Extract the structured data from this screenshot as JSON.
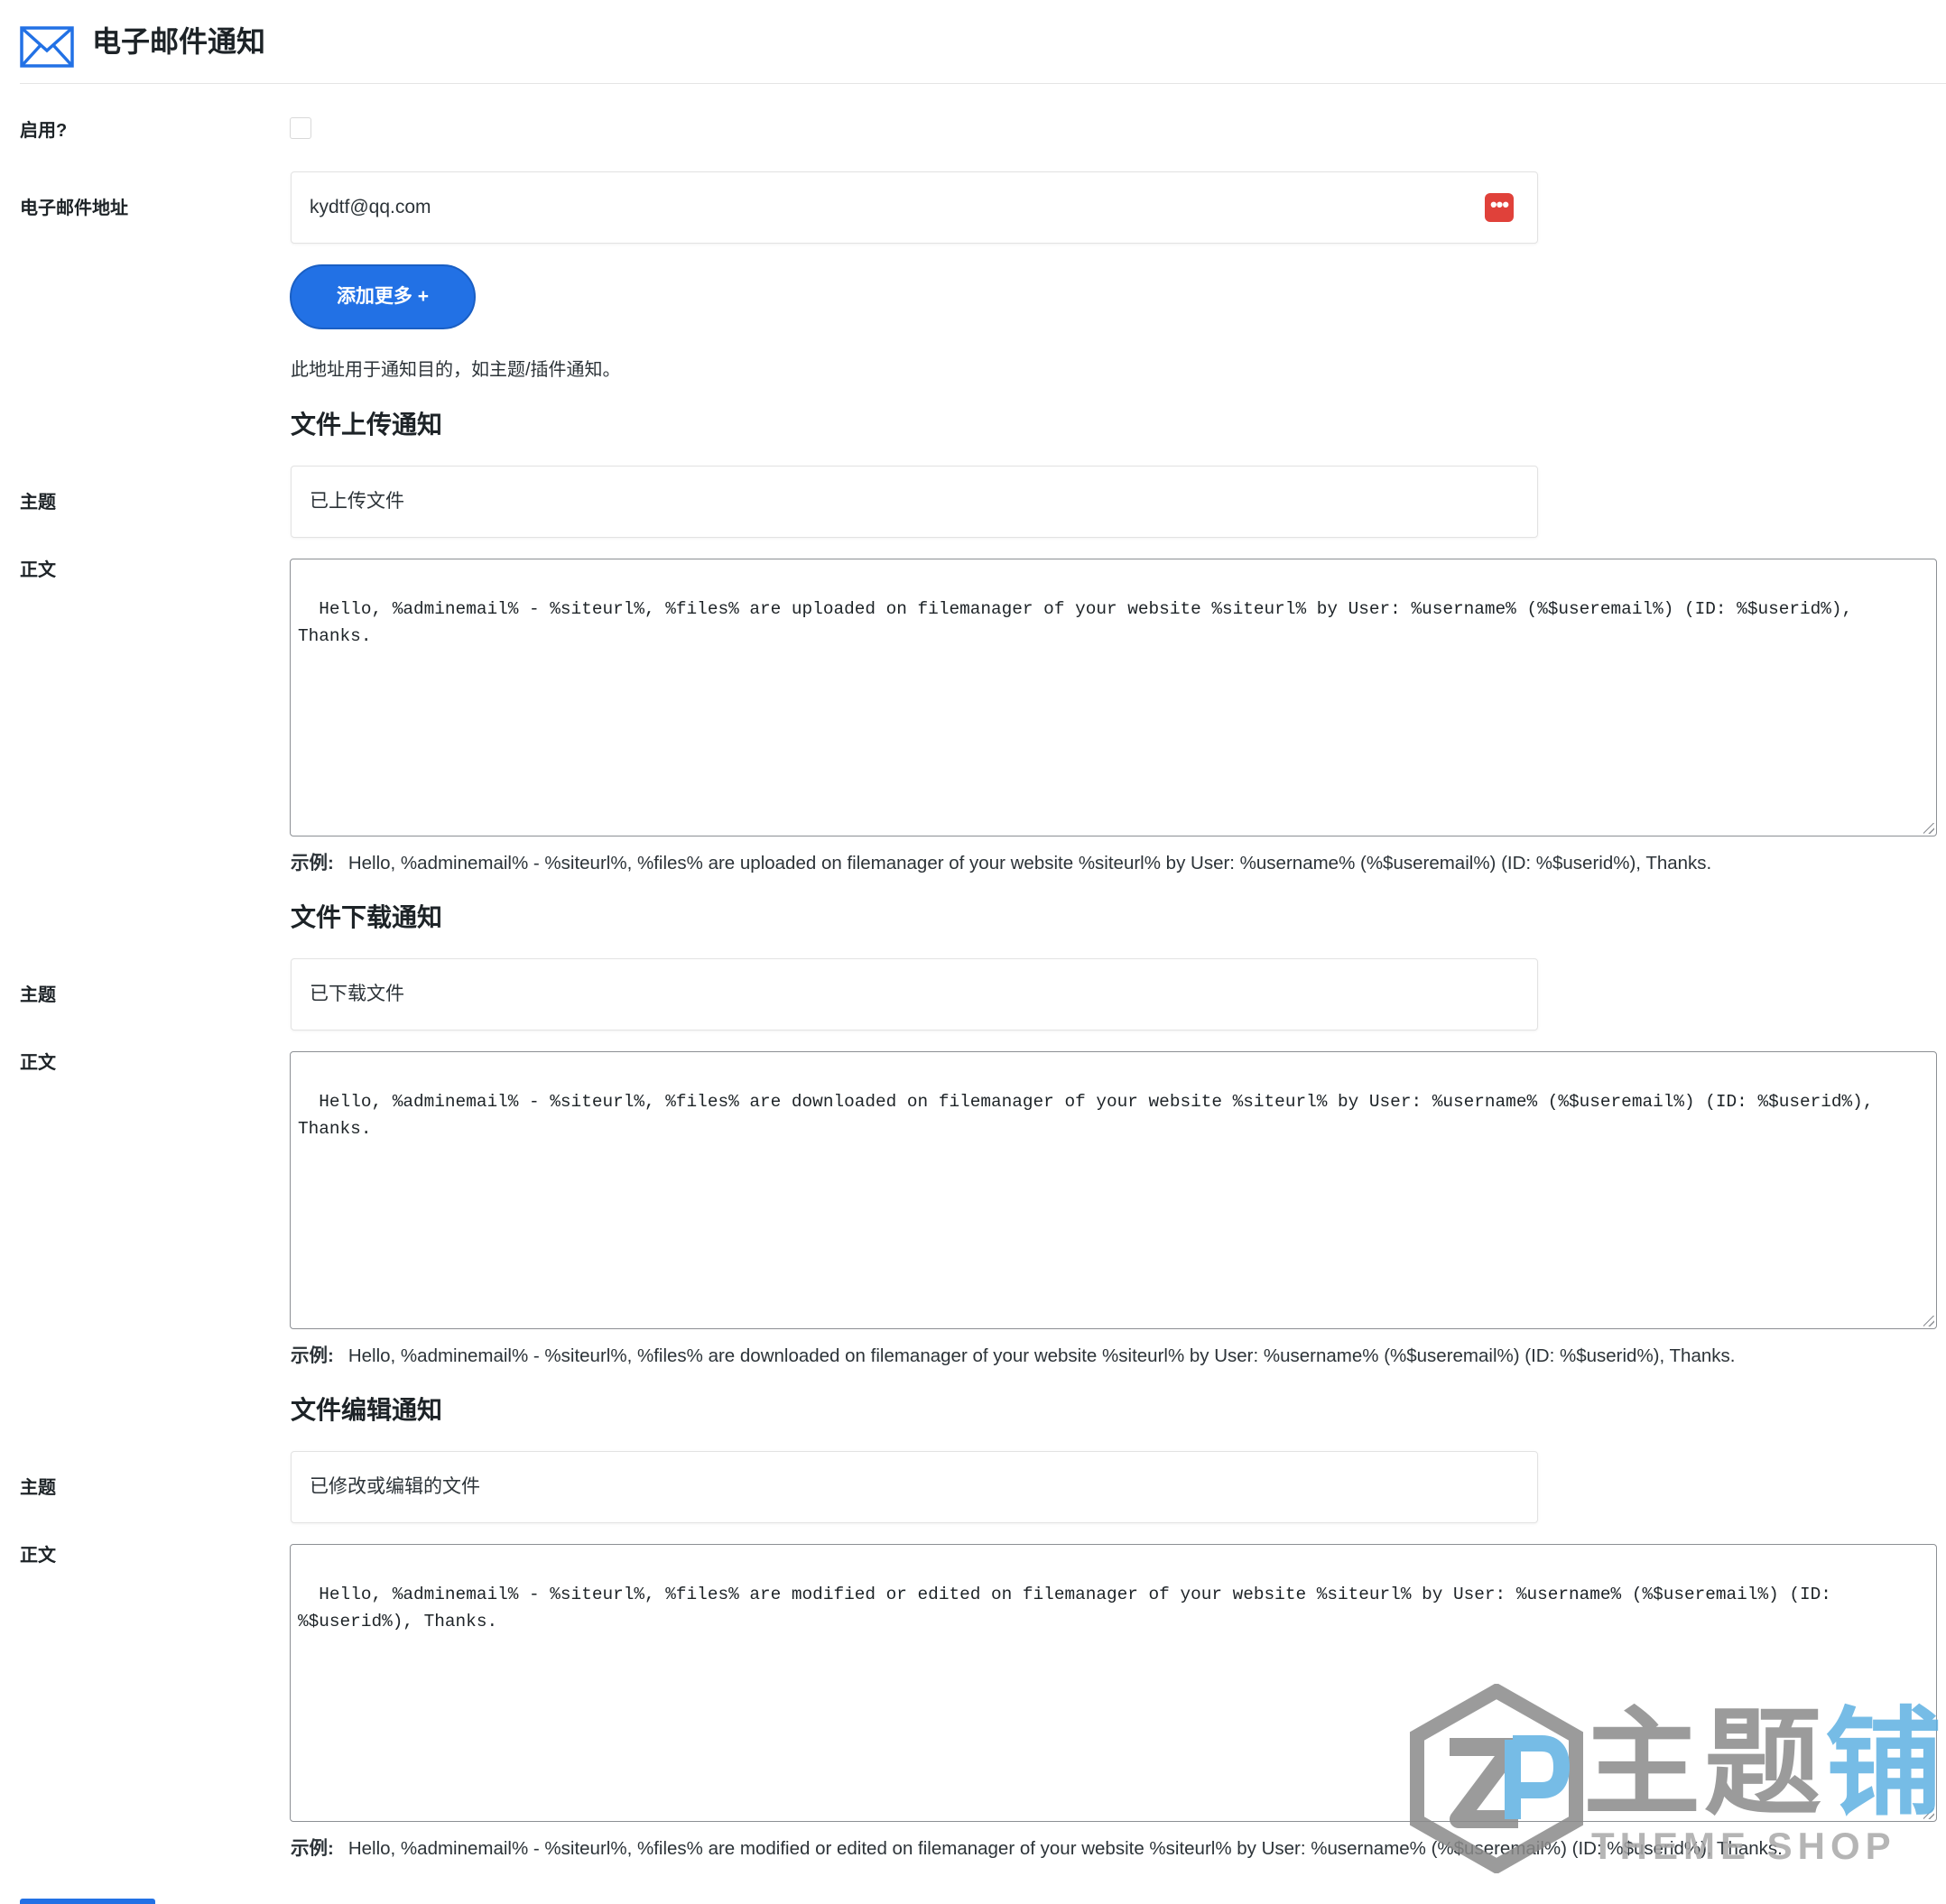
{
  "header": {
    "title": "电子邮件通知",
    "icon": "envelope-icon",
    "accent_color": "#2271e5"
  },
  "enable": {
    "label": "启用?",
    "checked": false
  },
  "email": {
    "label": "电子邮件地址",
    "value": "kydtf@qq.com",
    "icon": "password-manager-icon",
    "icon_color": "#e0413a"
  },
  "add_more": {
    "label": "添加更多 +",
    "color": "#2271e5"
  },
  "description": "此地址用于通知目的，如主题/插件通知。",
  "sections": [
    {
      "title": "文件上传通知",
      "subject_label": "主题",
      "subject_value": "已上传文件",
      "body_label": "正文",
      "body_value": "Hello, %adminemail% - %siteurl%, %files% are uploaded on filemanager of your website %siteurl% by User: %username% (%$useremail%) (ID: %$userid%), Thanks.",
      "example_label": "示例:",
      "example_value": "Hello, %adminemail% - %siteurl%, %files% are uploaded on filemanager of your website %siteurl% by User: %username% (%$useremail%) (ID: %$userid%), Thanks."
    },
    {
      "title": "文件下载通知",
      "subject_label": "主题",
      "subject_value": "已下载文件",
      "body_label": "正文",
      "body_value": "Hello, %adminemail% - %siteurl%, %files% are downloaded on filemanager of your website %siteurl% by User: %username% (%$useremail%) (ID: %$userid%), Thanks.",
      "example_label": "示例:",
      "example_value": "Hello, %adminemail% - %siteurl%, %files% are downloaded on filemanager of your website %siteurl% by User: %username% (%$useremail%) (ID: %$userid%), Thanks."
    },
    {
      "title": "文件编辑通知",
      "subject_label": "主题",
      "subject_value": "已修改或编辑的文件",
      "body_label": "正文",
      "body_value": "Hello, %adminemail% - %siteurl%, %files% are modified or edited on filemanager of your website %siteurl% by User: %username% (%$useremail%) (ID: %$userid%), Thanks.",
      "example_label": "示例:",
      "example_value": "Hello, %adminemail% - %siteurl%, %files% are modified or edited on filemanager of your website %siteurl% by User: %username% (%$useremail%) (ID: %$userid%), Thanks."
    }
  ],
  "watermark": {
    "logo": "zp-logo-icon",
    "text_gray": "主题",
    "text_blue": "铺",
    "subtext": "THEME SHOP",
    "gray_color": "#8a8a8a",
    "blue_color": "#5fb1e2"
  }
}
